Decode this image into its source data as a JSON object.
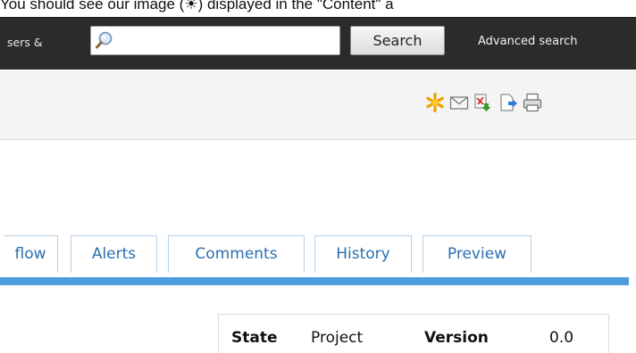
{
  "caption": "You should see our image (☀) displayed in the \"Content\" a",
  "header": {
    "left_link": "sers &",
    "search": {
      "value": "",
      "placeholder": ""
    },
    "search_button": "Search",
    "advanced_search": "Advanced search"
  },
  "toolbar": {
    "icons": [
      "add-favorite-icon",
      "email-icon",
      "pdf-export-icon",
      "word-export-icon",
      "print-icon"
    ]
  },
  "tabs": [
    {
      "label": "flow"
    },
    {
      "label": "Alerts"
    },
    {
      "label": "Comments"
    },
    {
      "label": "History"
    },
    {
      "label": "Preview"
    }
  ],
  "info": {
    "state_label": "State",
    "state_value": "Project",
    "version_label": "Version",
    "version_value": "0.0"
  },
  "colors": {
    "topbar": "#2b2b2b",
    "tab_text": "#2c6fae",
    "tab_underline": "#4c9de0"
  }
}
